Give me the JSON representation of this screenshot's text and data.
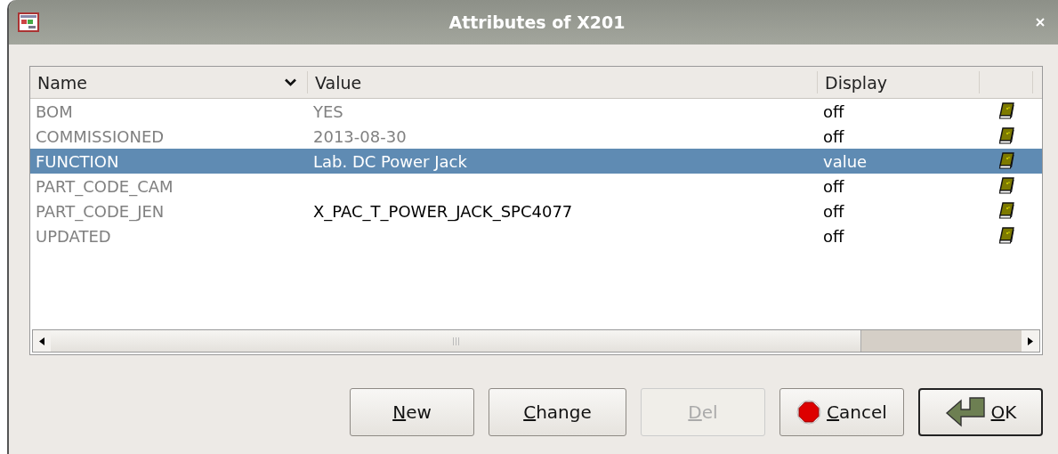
{
  "window": {
    "title": "Attributes of X201"
  },
  "table": {
    "columns": [
      {
        "label": "Name",
        "sorted": true
      },
      {
        "label": "Value",
        "sorted": false
      },
      {
        "label": "Display",
        "sorted": false
      }
    ],
    "rows": [
      {
        "name": "BOM",
        "value": "YES",
        "value_dimmed": true,
        "display": "off",
        "selected": false
      },
      {
        "name": "COMMISSIONED",
        "value": "2013-08-30",
        "value_dimmed": true,
        "display": "off",
        "selected": false
      },
      {
        "name": "FUNCTION",
        "value": "Lab. DC Power Jack",
        "value_dimmed": false,
        "display": "value",
        "selected": true
      },
      {
        "name": "PART_CODE_CAM",
        "display": "off",
        "selected": false
      },
      {
        "name": "PART_CODE_JEN",
        "value": "X_PAC_T_POWER_JACK_SPC4077",
        "value_dimmed": false,
        "display": "off",
        "selected": false
      },
      {
        "name": "UPDATED",
        "display": "off",
        "selected": false
      }
    ]
  },
  "buttons": [
    {
      "label": "New",
      "kind": "plain",
      "disabled": false,
      "default": false
    },
    {
      "label": "Change",
      "kind": "plain",
      "disabled": false,
      "default": false
    },
    {
      "label": "Del",
      "kind": "plain",
      "disabled": true,
      "default": false
    },
    {
      "label": "Cancel",
      "kind": "cancel",
      "disabled": false,
      "default": false
    },
    {
      "label": "OK",
      "kind": "ok",
      "disabled": false,
      "default": true
    }
  ]
}
